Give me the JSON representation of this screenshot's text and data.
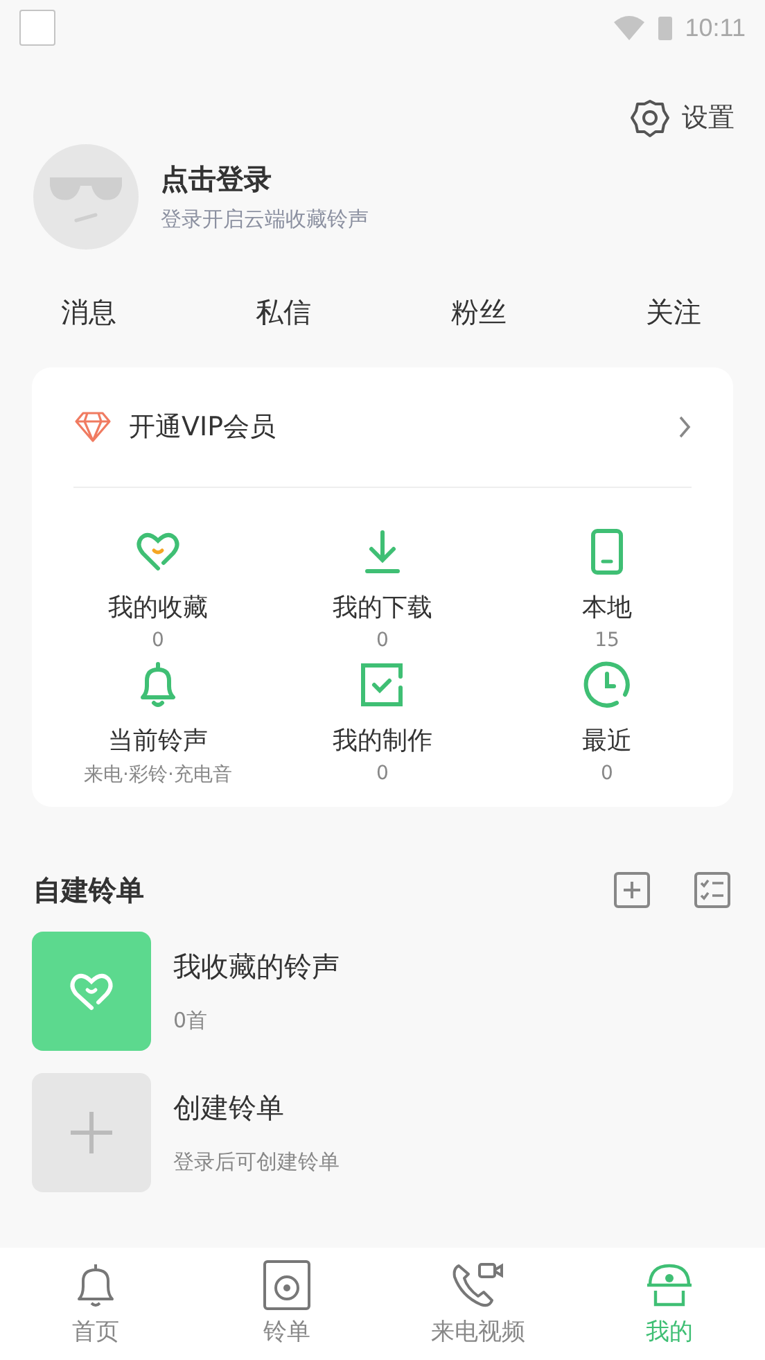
{
  "status_bar": {
    "time": "10:11"
  },
  "settings": {
    "label": "设置"
  },
  "profile": {
    "title": "点击登录",
    "subtitle": "登录开启云端收藏铃声"
  },
  "stats": [
    {
      "label": "消息"
    },
    {
      "label": "私信"
    },
    {
      "label": "粉丝"
    },
    {
      "label": "关注"
    }
  ],
  "vip": {
    "label": "开通VIP会员"
  },
  "features": [
    {
      "kind": "heart",
      "label": "我的收藏",
      "count": "0"
    },
    {
      "kind": "download",
      "label": "我的下载",
      "count": "0"
    },
    {
      "kind": "phone",
      "label": "本地",
      "count": "15"
    },
    {
      "kind": "bell",
      "label": "当前铃声",
      "count": "来电·彩铃·充电音"
    },
    {
      "kind": "check",
      "label": "我的制作",
      "count": "0"
    },
    {
      "kind": "clock",
      "label": "最近",
      "count": "0"
    }
  ],
  "playlists_section": {
    "title": "自建铃单"
  },
  "playlists": [
    {
      "kind": "favorites",
      "title": "我收藏的铃声",
      "subtitle": "0首"
    },
    {
      "kind": "create",
      "title": "创建铃单",
      "subtitle": "登录后可创建铃单"
    }
  ],
  "tabs": [
    {
      "kind": "bell",
      "label": "首页",
      "selected": false
    },
    {
      "kind": "disc",
      "label": "铃单",
      "selected": false
    },
    {
      "kind": "video-call",
      "label": "来电视频",
      "selected": false
    },
    {
      "kind": "hat",
      "label": "我的",
      "selected": true
    }
  ]
}
